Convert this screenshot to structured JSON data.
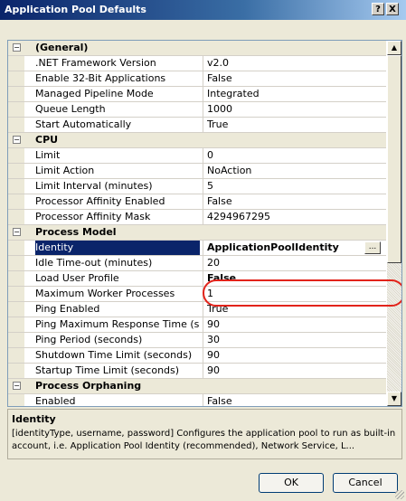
{
  "window": {
    "title": "Application Pool Defaults",
    "help_label": "?",
    "close_label": "X"
  },
  "grid": {
    "rows": [
      {
        "type": "category",
        "toggle": "−",
        "name": "(General)"
      },
      {
        "type": "prop",
        "name": ".NET Framework Version",
        "value": "v2.0"
      },
      {
        "type": "prop",
        "name": "Enable 32-Bit Applications",
        "value": "False"
      },
      {
        "type": "prop",
        "name": "Managed Pipeline Mode",
        "value": "Integrated"
      },
      {
        "type": "prop",
        "name": "Queue Length",
        "value": "1000"
      },
      {
        "type": "prop",
        "name": "Start Automatically",
        "value": "True"
      },
      {
        "type": "category",
        "toggle": "−",
        "name": "CPU"
      },
      {
        "type": "prop",
        "name": "Limit",
        "value": "0"
      },
      {
        "type": "prop",
        "name": "Limit Action",
        "value": "NoAction"
      },
      {
        "type": "prop",
        "name": "Limit Interval (minutes)",
        "value": "5"
      },
      {
        "type": "prop",
        "name": "Processor Affinity Enabled",
        "value": "False"
      },
      {
        "type": "prop",
        "name": "Processor Affinity Mask",
        "value": "4294967295"
      },
      {
        "type": "category",
        "toggle": "−",
        "name": "Process Model"
      },
      {
        "type": "prop",
        "name": "Identity",
        "value": "ApplicationPoolIdentity",
        "selected": true,
        "ellipsis": "..."
      },
      {
        "type": "prop",
        "name": "Idle Time-out (minutes)",
        "value": "20"
      },
      {
        "type": "prop",
        "name": "Load User Profile",
        "value": "False",
        "bold": true
      },
      {
        "type": "prop",
        "name": "Maximum Worker Processes",
        "value": "1"
      },
      {
        "type": "prop",
        "name": "Ping Enabled",
        "value": "True"
      },
      {
        "type": "prop",
        "name": "Ping Maximum Response Time (seconds)",
        "value": "90"
      },
      {
        "type": "prop",
        "name": "Ping Period (seconds)",
        "value": "30"
      },
      {
        "type": "prop",
        "name": "Shutdown Time Limit (seconds)",
        "value": "90"
      },
      {
        "type": "prop",
        "name": "Startup Time Limit (seconds)",
        "value": "90"
      },
      {
        "type": "category",
        "toggle": "−",
        "name": "Process Orphaning"
      },
      {
        "type": "prop",
        "name": "Enabled",
        "value": "False"
      }
    ]
  },
  "scrollbar": {
    "up_label": "▲",
    "down_label": "▼"
  },
  "description": {
    "title": "Identity",
    "text": "[identityType, username, password] Configures the application pool to run as built-in account, i.e. Application Pool Identity (recommended), Network Service, L..."
  },
  "buttons": {
    "ok": "OK",
    "cancel": "Cancel"
  },
  "colors": {
    "selection": "#0a246a",
    "annotation": "#e2231a",
    "titlebar": "#0a246a"
  },
  "icons": [
    "collapse-toggle-icon",
    "ellipsis-button",
    "scroll-up-icon",
    "scroll-down-icon",
    "resize-grip-icon"
  ]
}
